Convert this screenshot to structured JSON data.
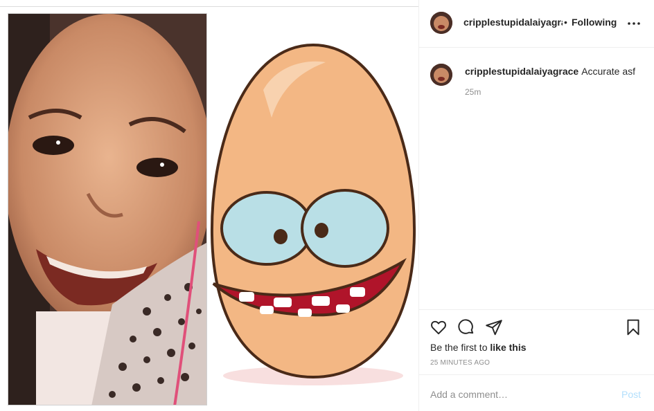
{
  "post": {
    "author": "cripplestupidalaiyagrace",
    "follow_separator": "•",
    "follow_status": "Following",
    "caption": "Accurate asf",
    "caption_time": "25m",
    "likes_prefix": "Be the first to",
    "likes_action": "like this",
    "timestamp": "25 MINUTES AGO"
  },
  "comment_box": {
    "placeholder": "Add a comment…",
    "post_label": "Post"
  },
  "colors": {
    "egg_fill": "#f3b784",
    "egg_outline": "#4a2a18",
    "eye_fill": "#b9dfe6",
    "mouth_fill": "#b0142a",
    "post_disabled": "#b2dffc",
    "border": "#efefef"
  },
  "icons": {
    "more": "more-options-icon",
    "like": "heart-icon",
    "comment": "comment-bubble-icon",
    "share": "paper-plane-icon",
    "save": "bookmark-icon"
  }
}
